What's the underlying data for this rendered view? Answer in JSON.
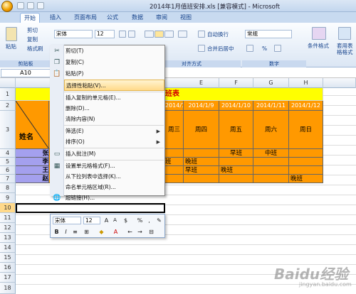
{
  "window": {
    "title": "2014年1月值班安排.xls  [兼容模式] - Microsoft"
  },
  "tabs": [
    "开始",
    "插入",
    "页面布局",
    "公式",
    "数据",
    "审阅",
    "视图"
  ],
  "ribbon": {
    "paste_label": "粘贴",
    "cut_label": "剪切",
    "copy_label": "复制",
    "format_painter_label": "格式刷",
    "clipboard_group": "剪贴板",
    "font_name": "宋体",
    "font_size": "12",
    "wrap_text_label": "自动换行",
    "merge_center_label": "合并后居中",
    "alignment_group": "对齐方式",
    "number_format": "常规",
    "number_group": "数字",
    "percent_symbol": "%",
    "conditional_format_label": "条件格式",
    "table_format_label": "套用表格格式"
  },
  "formula_bar": {
    "name_box": "A10"
  },
  "columns": [
    "E",
    "F",
    "G",
    "H"
  ],
  "rows": [
    "1",
    "2",
    "3",
    "4",
    "5",
    "6",
    "7",
    "8",
    "9",
    "10",
    "11",
    "12",
    "13",
    "14",
    "15",
    "16",
    "17",
    "18"
  ],
  "sheet": {
    "title_fragment": "班表",
    "name_header": "姓名",
    "dates": [
      "2014/1/8",
      "2014/1/9",
      "2014/1/10",
      "2014/1/11",
      "2014/1/12"
    ],
    "weekdays": [
      "周三",
      "周四",
      "周五",
      "周六",
      "周日"
    ],
    "names_fragments": [
      "张",
      "李",
      "王",
      "赵"
    ],
    "row4": [
      "",
      "",
      "早班",
      "中班",
      ""
    ],
    "row5": [
      "班",
      "晚班",
      "",
      "",
      ""
    ],
    "row6": [
      "",
      "早班",
      "晚班",
      "",
      ""
    ],
    "row7": [
      "",
      "",
      "",
      "",
      "晚班"
    ]
  },
  "context_menu": {
    "items": [
      {
        "label": "剪切(T)",
        "icon": "scissors-icon"
      },
      {
        "label": "复制(C)",
        "icon": "copy-icon"
      },
      {
        "label": "粘贴(P)",
        "icon": "paste-icon"
      },
      {
        "label": "选择性粘贴(V)...",
        "icon": ""
      },
      {
        "label": "插入复制的单元格(E)...",
        "icon": ""
      },
      {
        "label": "删除(D)...",
        "icon": ""
      },
      {
        "label": "清除内容(N)",
        "icon": ""
      },
      {
        "label": "筛选(E)",
        "icon": ""
      },
      {
        "label": "排序(O)",
        "icon": ""
      },
      {
        "label": "插入批注(M)",
        "icon": "comment-icon"
      },
      {
        "label": "设置单元格格式(F)...",
        "icon": "format-cells-icon"
      },
      {
        "label": "从下拉列表中选择(K)...",
        "icon": ""
      },
      {
        "label": "命名单元格区域(R)...",
        "icon": ""
      },
      {
        "label": "超链接(H)...",
        "icon": "hyperlink-icon"
      }
    ]
  },
  "mini_toolbar": {
    "font_name": "宋体",
    "font_size": "12",
    "bold": "B",
    "italic": "I",
    "percent": "%",
    "comma": ","
  },
  "watermark": {
    "text": "Baidu经验",
    "sub": "jingyan.baidu.com"
  },
  "colors": {
    "yellow": "#ffff00",
    "orange": "#ff9900",
    "purple": "#a4a0ee",
    "menu_highlight": "#ffd98a"
  }
}
